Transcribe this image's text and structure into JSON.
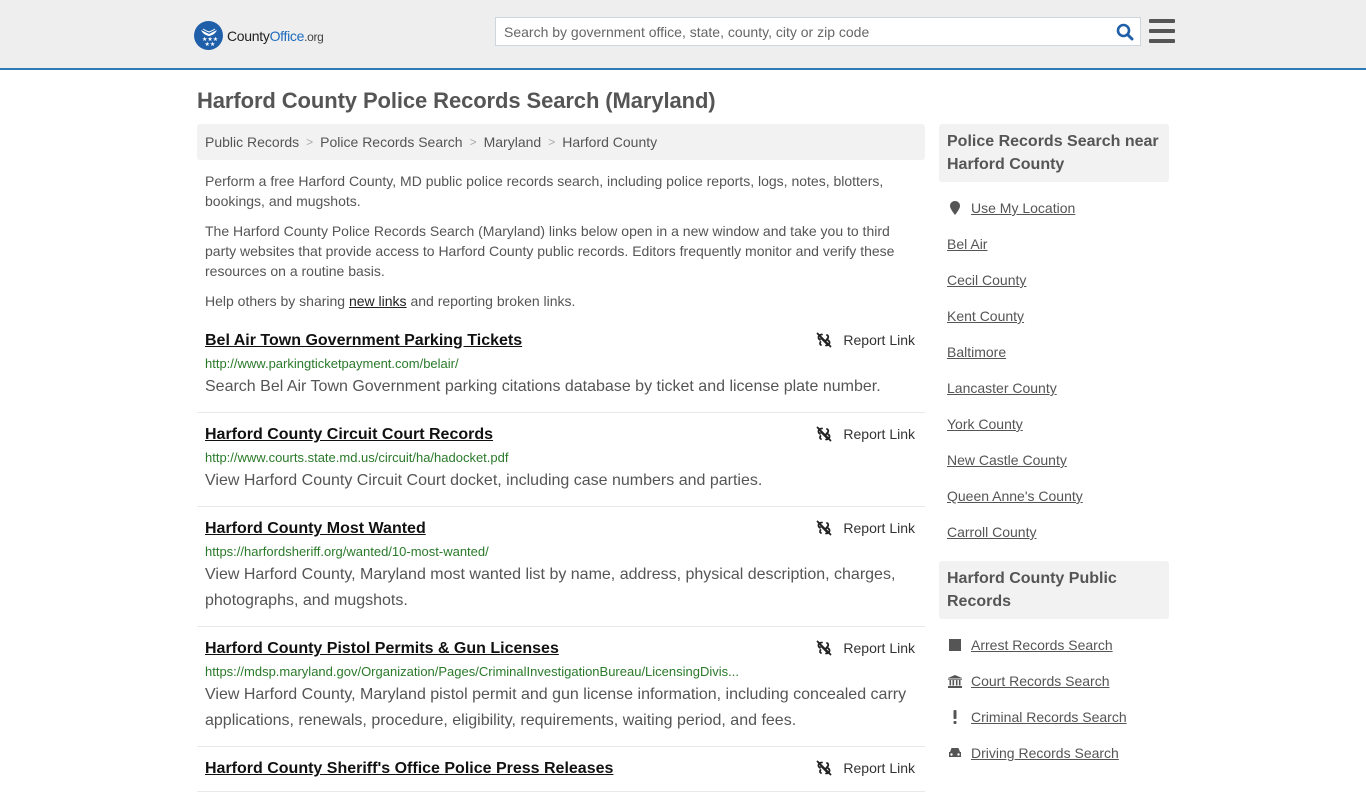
{
  "header": {
    "logo": {
      "county": "County",
      "office": "Office",
      "org": ".org"
    },
    "search_placeholder": "Search by government office, state, county, city or zip code",
    "search_value": "",
    "icons": {
      "search": "search-icon",
      "menu": "hamburger-menu-icon"
    },
    "accent_color": "#2e78b5"
  },
  "page": {
    "title": "Harford County Police Records Search (Maryland)"
  },
  "breadcrumb": [
    {
      "label": "Public Records"
    },
    {
      "label": "Police Records Search"
    },
    {
      "label": "Maryland"
    },
    {
      "label": "Harford County"
    }
  ],
  "intro": {
    "p1": "Perform a free Harford County, MD public police records search, including police reports, logs, notes, blotters, bookings, and mugshots.",
    "p2": "The Harford County Police Records Search (Maryland) links below open in a new window and take you to third party websites that provide access to Harford County public records. Editors frequently monitor and verify these resources on a routine basis.",
    "p3_before": "Help others by sharing ",
    "p3_link": "new links",
    "p3_after": " and reporting broken links."
  },
  "results": [
    {
      "title": "Bel Air Town Government Parking Tickets",
      "url": "http://www.parkingticketpayment.com/belair/",
      "description": "Search Bel Air Town Government parking citations database by ticket and license plate number.",
      "report_label": "Report Link"
    },
    {
      "title": "Harford County Circuit Court Records",
      "url": "http://www.courts.state.md.us/circuit/ha/hadocket.pdf",
      "description": "View Harford County Circuit Court docket, including case numbers and parties.",
      "report_label": "Report Link"
    },
    {
      "title": "Harford County Most Wanted",
      "url": "https://harfordsheriff.org/wanted/10-most-wanted/",
      "description": "View Harford County, Maryland most wanted list by name, address, physical description, charges, photographs, and mugshots.",
      "report_label": "Report Link"
    },
    {
      "title": "Harford County Pistol Permits & Gun Licenses",
      "url": "https://mdsp.maryland.gov/Organization/Pages/CriminalInvestigationBureau/LicensingDivis...",
      "description": "View Harford County, Maryland pistol permit and gun license information, including concealed carry applications, renewals, procedure, eligibility, requirements, waiting period, and fees.",
      "report_label": "Report Link"
    },
    {
      "title": "Harford County Sheriff's Office Police Press Releases",
      "url": "",
      "description": "",
      "report_label": "Report Link"
    }
  ],
  "sidebar": {
    "nearby": {
      "heading": "Police Records Search near Harford County",
      "use_location": "Use My Location",
      "items": [
        "Bel Air",
        "Cecil County",
        "Kent County",
        "Baltimore",
        "Lancaster County",
        "York County",
        "New Castle County",
        "Queen Anne's County",
        "Carroll County"
      ]
    },
    "public_records": {
      "heading": "Harford County Public Records",
      "items": [
        {
          "label": "Arrest Records Search",
          "icon": "square-icon"
        },
        {
          "label": "Court Records Search",
          "icon": "courthouse-icon"
        },
        {
          "label": "Criminal Records Search",
          "icon": "exclamation-icon"
        },
        {
          "label": "Driving Records Search",
          "icon": "car-icon"
        }
      ]
    }
  }
}
